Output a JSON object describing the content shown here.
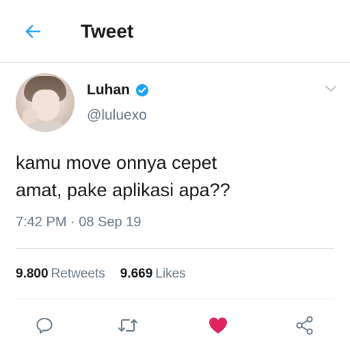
{
  "header": {
    "title": "Tweet"
  },
  "tweet": {
    "author_name": "Luhan",
    "author_handle": "@luluexo",
    "verified": true,
    "text_lines": [
      "kamu move onnya cepet",
      "amat, pake aplikasi apa??"
    ],
    "timestamp": "7:42 PM · 08 Sep 19",
    "retweets_count": "9.800",
    "retweets_label": "Retweets",
    "likes_count": "9.669",
    "likes_label": "Likes",
    "liked": true
  },
  "colors": {
    "accent": "#1da1f2",
    "like": "#e0245e",
    "secondary_text": "#657786",
    "icon_gray": "#657786"
  },
  "icons": {
    "back": "arrow-left-icon",
    "verified": "verified-badge-icon",
    "caret": "chevron-down-icon",
    "reply": "reply-icon",
    "retweet": "retweet-icon",
    "like": "heart-icon",
    "share": "share-icon"
  }
}
